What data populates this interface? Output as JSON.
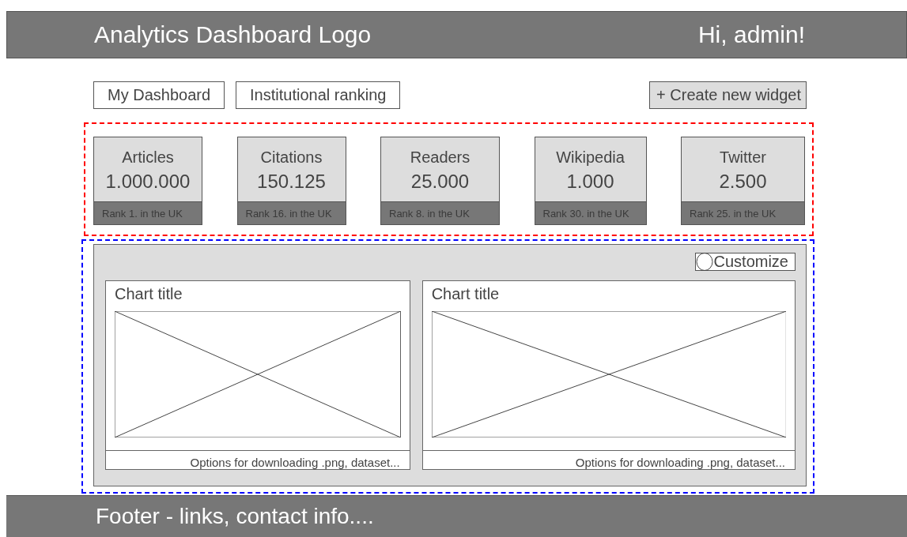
{
  "header": {
    "logo": "Analytics Dashboard Logo",
    "greeting": "Hi, admin!"
  },
  "tabs": [
    {
      "label": "My Dashboard"
    },
    {
      "label": "Institutional ranking"
    }
  ],
  "create_button": "+ Create new widget",
  "metrics": [
    {
      "label": "Articles",
      "value": "1.000.000",
      "rank": "Rank 1. in the UK"
    },
    {
      "label": "Citations",
      "value": "150.125",
      "rank": "Rank 16. in the UK"
    },
    {
      "label": "Readers",
      "value": "25.000",
      "rank": "Rank 8. in the UK"
    },
    {
      "label": "Wikipedia",
      "value": "1.000",
      "rank": "Rank 30. in the UK"
    },
    {
      "label": "Twitter",
      "value": "2.500",
      "rank": "Rank 25. in the UK"
    }
  ],
  "customize_button": "Customize",
  "charts": [
    {
      "title": "Chart title",
      "footer": "Options for downloading .png, dataset..."
    },
    {
      "title": "Chart title",
      "footer": "Options for downloading .png, dataset..."
    }
  ],
  "footer": "Footer - links, contact info...."
}
